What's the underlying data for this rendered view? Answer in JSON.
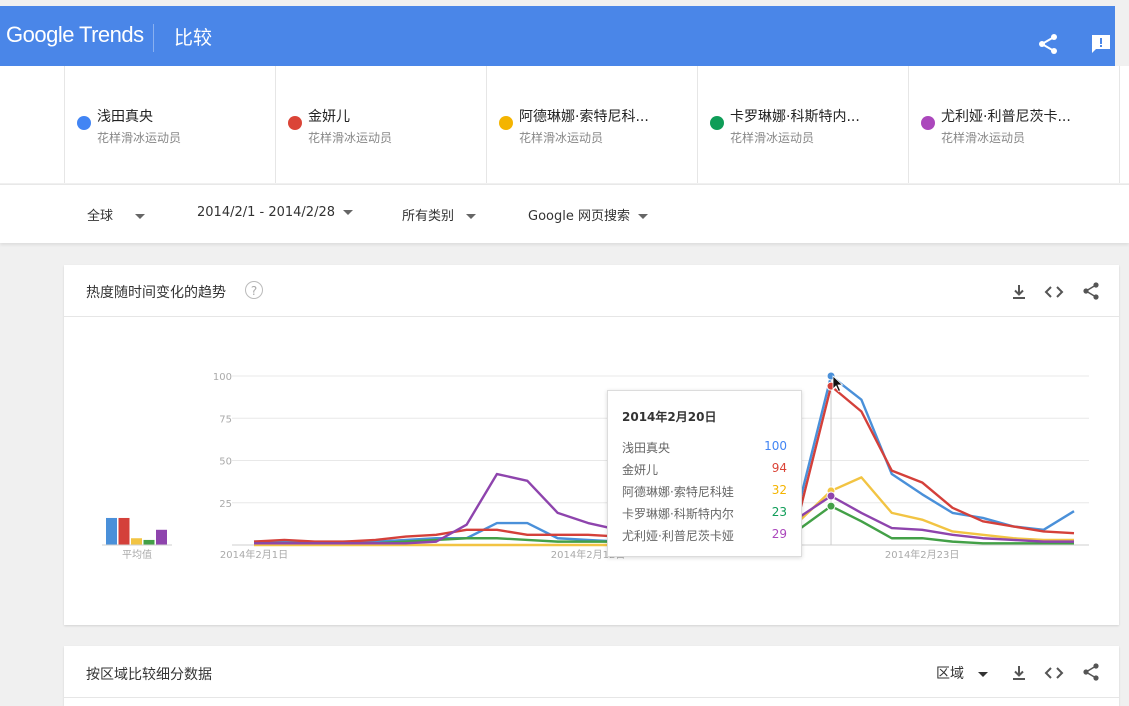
{
  "header": {
    "brand_google": "Google",
    "brand_trends": "Trends",
    "title": "比较",
    "color": "#4a86e8"
  },
  "terms": [
    {
      "name": "浅田真央",
      "sub": "花样滑冰运动员",
      "color": "#4285f4"
    },
    {
      "name": "金妍儿",
      "sub": "花样滑冰运动员",
      "color": "#db4437"
    },
    {
      "name": "阿德琳娜·索特尼科...",
      "sub": "花样滑冰运动员",
      "color": "#f4b400"
    },
    {
      "name": "卡罗琳娜·科斯特内...",
      "sub": "花样滑冰运动员",
      "color": "#0f9d58"
    },
    {
      "name": "尤利娅·利普尼茨卡...",
      "sub": "花样滑冰运动员",
      "color": "#ab47bc"
    }
  ],
  "filters": {
    "region": "全球",
    "date_range": "2014/2/1 - 2014/2/28",
    "category": "所有类别",
    "search_type": "Google 网页搜索"
  },
  "interest_card": {
    "title": "热度随时间变化的趋势",
    "help": "?",
    "avg_label": "平均值",
    "tooltip": {
      "date": "2014年2月20日",
      "rows": [
        {
          "label": "浅田真央",
          "value": "100"
        },
        {
          "label": "金妍儿",
          "value": "94"
        },
        {
          "label": "阿德琳娜·索特尼科娃",
          "value": "32"
        },
        {
          "label": "卡罗琳娜·科斯特内尔",
          "value": "23"
        },
        {
          "label": "尤利娅·利普尼茨卡娅",
          "value": "29"
        }
      ]
    }
  },
  "region_card": {
    "title": "按区域比较细分数据",
    "region_select": "区域"
  },
  "chart_data": {
    "type": "line",
    "x_tick_labels": [
      "2014年2月1日",
      "2014年2月12日",
      "2014年2月23日"
    ],
    "x_tick_days": [
      1,
      12,
      23
    ],
    "ylim": [
      0,
      100
    ],
    "y_ticks": [
      100,
      75,
      50,
      25
    ],
    "days": [
      1,
      2,
      3,
      4,
      5,
      6,
      7,
      8,
      9,
      10,
      11,
      12,
      13,
      14,
      15,
      16,
      17,
      18,
      19,
      20,
      21,
      22,
      23,
      24,
      25,
      26,
      27,
      28
    ],
    "series": [
      {
        "name": "浅田真央",
        "color": "#4a90d9",
        "values": [
          2,
          2,
          1,
          2,
          2,
          3,
          4,
          4,
          13,
          13,
          4,
          3,
          2,
          3,
          4,
          4,
          6,
          9,
          28,
          100,
          86,
          42,
          30,
          19,
          16,
          11,
          9,
          20
        ]
      },
      {
        "name": "金妍儿",
        "color": "#d4403a",
        "values": [
          2,
          3,
          2,
          2,
          3,
          5,
          6,
          9,
          9,
          6,
          6,
          6,
          5,
          6,
          7,
          6,
          7,
          9,
          22,
          94,
          79,
          44,
          37,
          22,
          14,
          11,
          8,
          7
        ]
      },
      {
        "name": "阿德琳娜·索特尼科娃",
        "color": "#f2c443",
        "values": [
          0,
          0,
          0,
          0,
          0,
          0,
          0,
          0,
          0,
          0,
          0,
          0,
          0,
          0,
          0,
          0,
          1,
          4,
          15,
          32,
          40,
          19,
          15,
          8,
          6,
          4,
          3,
          3
        ]
      },
      {
        "name": "卡罗琳娜·科斯特内尔",
        "color": "#43a047",
        "values": [
          1,
          1,
          1,
          1,
          1,
          2,
          3,
          4,
          4,
          3,
          2,
          2,
          2,
          2,
          3,
          3,
          4,
          5,
          10,
          23,
          14,
          4,
          4,
          2,
          1,
          1,
          1,
          1
        ]
      },
      {
        "name": "尤利娅·利普尼茨卡娅",
        "color": "#8e44ad",
        "values": [
          1,
          1,
          1,
          1,
          1,
          1,
          2,
          12,
          42,
          38,
          19,
          13,
          9,
          7,
          6,
          5,
          6,
          9,
          17,
          29,
          19,
          10,
          9,
          6,
          4,
          3,
          2,
          2
        ]
      }
    ],
    "averages": [
      16,
      16,
      4,
      3,
      9
    ],
    "highlight_day": 20
  }
}
